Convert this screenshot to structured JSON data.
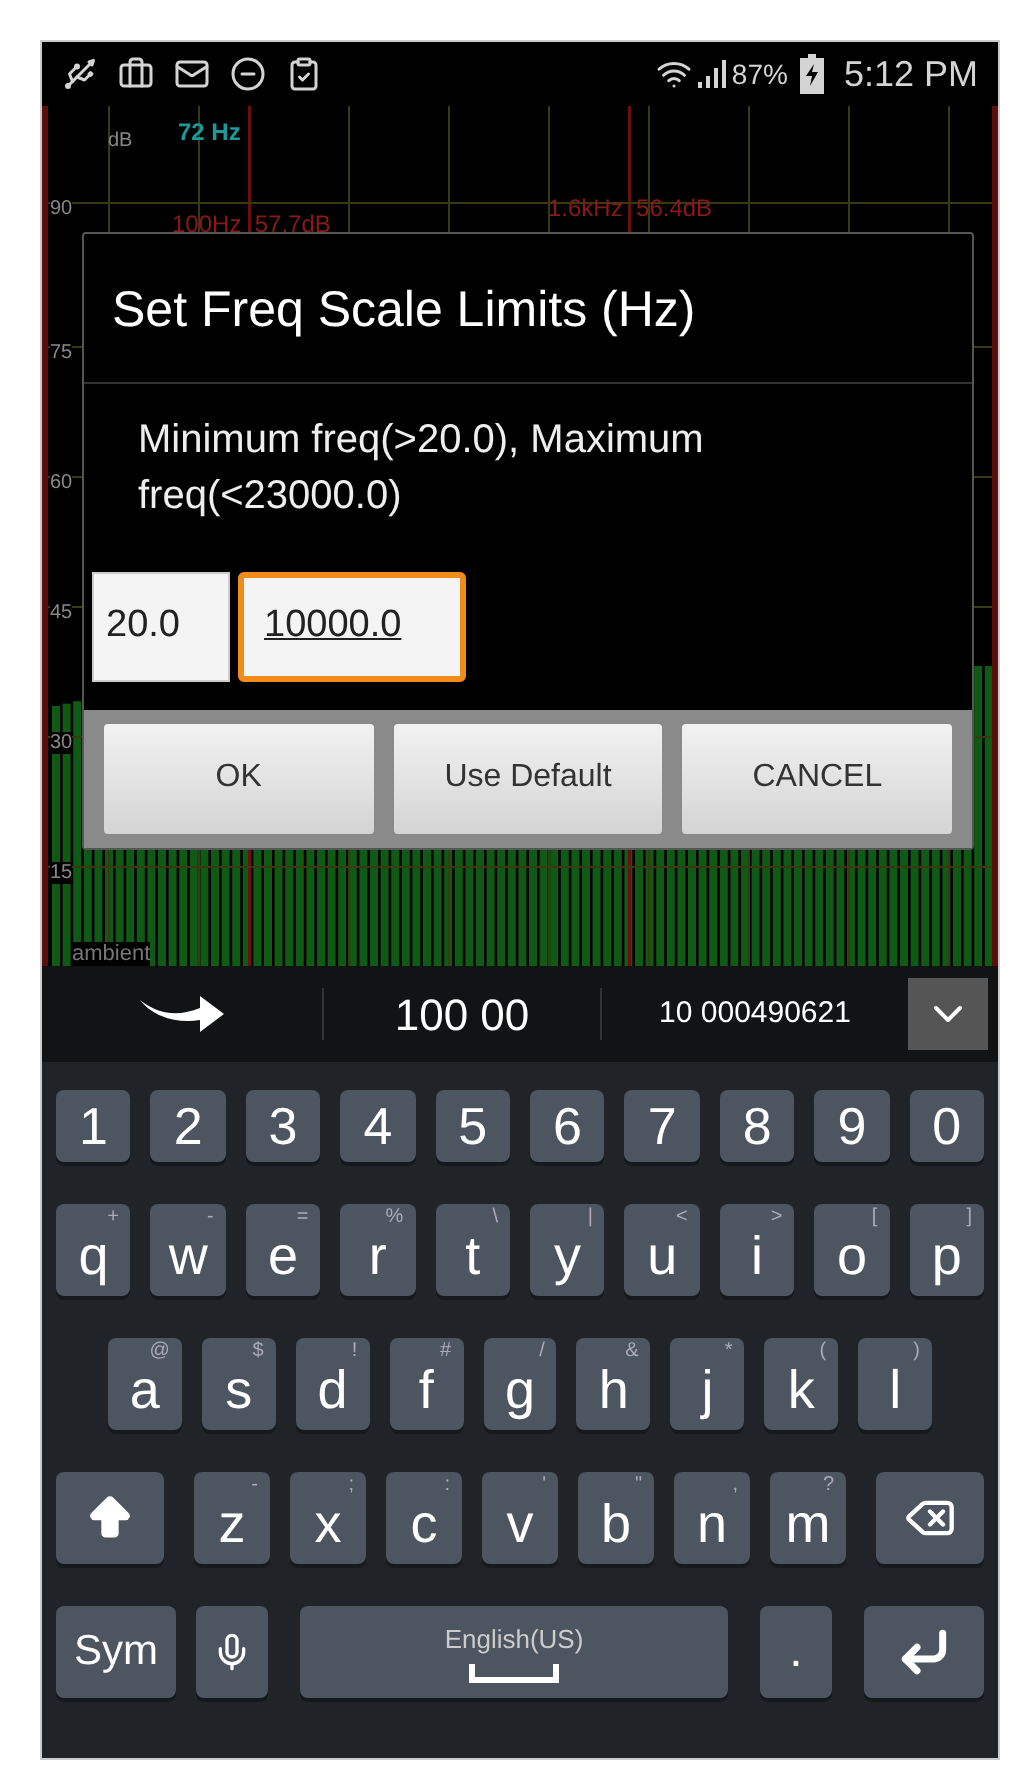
{
  "status_bar": {
    "battery": "87%",
    "time": "5:12 PM"
  },
  "spectrum": {
    "unit": "dB",
    "peak": "72 Hz",
    "y_labels": [
      "90",
      "75",
      "60",
      "45",
      "30",
      "15"
    ],
    "markers": [
      "100Hz  57.7dB",
      "1.6kHz  56.4dB"
    ],
    "mode": "ambient"
  },
  "dialog": {
    "title": "Set Freq Scale Limits (Hz)",
    "message": "Minimum freq(>20.0), Maximum freq(<23000.0)",
    "fields": [
      {
        "value": "20.0",
        "focused": false
      },
      {
        "value": "10000.0",
        "focused": true
      }
    ],
    "buttons": [
      "OK",
      "Use Default",
      "CANCEL"
    ]
  },
  "keyboard": {
    "suggestions": [
      "100 00",
      "10 000490621"
    ],
    "rows": [
      {
        "keys": [
          {
            "kind": "char",
            "label": "1"
          },
          {
            "kind": "char",
            "label": "2"
          },
          {
            "kind": "char",
            "label": "3"
          },
          {
            "kind": "char",
            "label": "4"
          },
          {
            "kind": "char",
            "label": "5"
          },
          {
            "kind": "char",
            "label": "6"
          },
          {
            "kind": "char",
            "label": "7"
          },
          {
            "kind": "char",
            "label": "8"
          },
          {
            "kind": "char",
            "label": "9"
          },
          {
            "kind": "char",
            "label": "0"
          }
        ]
      },
      {
        "keys": [
          {
            "kind": "char",
            "label": "q",
            "hint": "+"
          },
          {
            "kind": "char",
            "label": "w",
            "hint": "-"
          },
          {
            "kind": "char",
            "label": "e",
            "hint": "="
          },
          {
            "kind": "char",
            "label": "r",
            "hint": "%"
          },
          {
            "kind": "char",
            "label": "t",
            "hint": "\\"
          },
          {
            "kind": "char",
            "label": "y",
            "hint": "|"
          },
          {
            "kind": "char",
            "label": "u",
            "hint": "<"
          },
          {
            "kind": "char",
            "label": "i",
            "hint": ">"
          },
          {
            "kind": "char",
            "label": "o",
            "hint": "["
          },
          {
            "kind": "char",
            "label": "p",
            "hint": "]"
          }
        ]
      },
      {
        "keys": [
          {
            "kind": "char",
            "label": "a",
            "hint": "@"
          },
          {
            "kind": "char",
            "label": "s",
            "hint": "$"
          },
          {
            "kind": "char",
            "label": "d",
            "hint": "!"
          },
          {
            "kind": "char",
            "label": "f",
            "hint": "#"
          },
          {
            "kind": "char",
            "label": "g",
            "hint": "/"
          },
          {
            "kind": "char",
            "label": "h",
            "hint": "&"
          },
          {
            "kind": "char",
            "label": "j",
            "hint": "*"
          },
          {
            "kind": "char",
            "label": "k",
            "hint": "("
          },
          {
            "kind": "char",
            "label": "l",
            "hint": ")"
          }
        ]
      },
      {
        "keys": [
          {
            "kind": "shift"
          },
          {
            "kind": "char",
            "label": "z",
            "hint": "-"
          },
          {
            "kind": "char",
            "label": "x",
            "hint": ";"
          },
          {
            "kind": "char",
            "label": "c",
            "hint": ":"
          },
          {
            "kind": "char",
            "label": "v",
            "hint": "'"
          },
          {
            "kind": "char",
            "label": "b",
            "hint": "\""
          },
          {
            "kind": "char",
            "label": "n",
            "hint": ","
          },
          {
            "kind": "char",
            "label": "m",
            "hint": "?"
          },
          {
            "kind": "backspace"
          }
        ]
      },
      {
        "keys": [
          {
            "kind": "sym",
            "label": "Sym"
          },
          {
            "kind": "mic"
          },
          {
            "kind": "space",
            "label": "English(US)"
          },
          {
            "kind": "period",
            "label": "."
          },
          {
            "kind": "enter"
          }
        ]
      }
    ]
  }
}
